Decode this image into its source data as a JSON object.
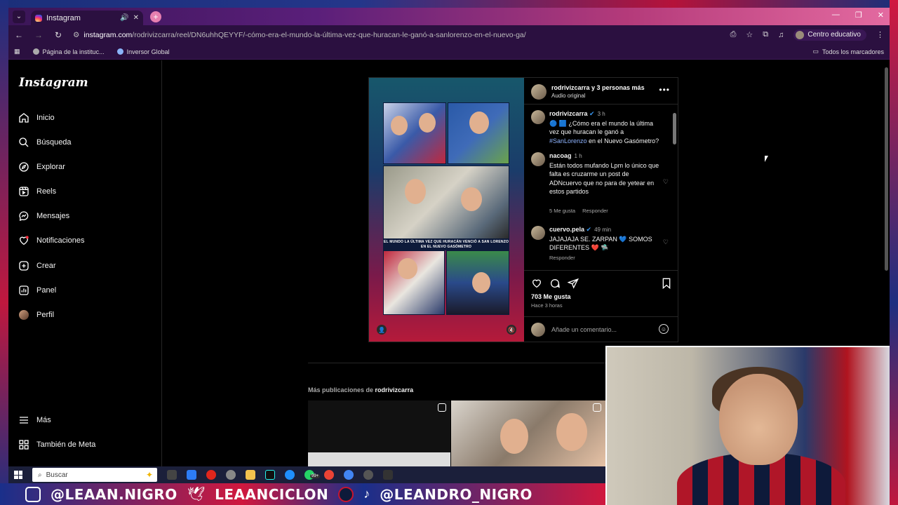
{
  "browser": {
    "tab_title": "Instagram",
    "url_host": "instagram.com",
    "url_path": "/rodrivizcarra/reel/DN6uhhQEYYF/-cómo-era-el-mundo-la-última-vez-que-huracan-le-ganó-a-sanlorenzo-en-el-nuevo-ga/",
    "profile_label": "Centro educativo",
    "bookmarks": [
      "Página de la instituc...",
      "Inversor Global"
    ],
    "bookmarks_right": "Todos los marcadores"
  },
  "instagram": {
    "logo": "Instagram",
    "nav": [
      {
        "label": "Inicio",
        "icon": "home-icon"
      },
      {
        "label": "Búsqueda",
        "icon": "search-icon"
      },
      {
        "label": "Explorar",
        "icon": "compass-icon"
      },
      {
        "label": "Reels",
        "icon": "reels-icon"
      },
      {
        "label": "Mensajes",
        "icon": "messenger-icon"
      },
      {
        "label": "Notificaciones",
        "icon": "heart-icon"
      },
      {
        "label": "Crear",
        "icon": "plus-square-icon"
      },
      {
        "label": "Panel",
        "icon": "dashboard-icon"
      },
      {
        "label": "Perfil",
        "icon": "avatar"
      }
    ],
    "nav_bottom": [
      {
        "label": "Más",
        "icon": "menu-icon"
      },
      {
        "label": "También de Meta",
        "icon": "meta-grid-icon"
      }
    ],
    "post": {
      "header_user": "rodrivizcarra y 3 personas más",
      "header_sub": "Audio original",
      "image_caption": "EL MUNDO LA ÚLTIMA VEZ QUE HURACÁN VENCIÓ A SAN LORENZO EN EL NUEVO GASÓMETRO",
      "comments": [
        {
          "user": "rodrivizcarra",
          "time": "3 h",
          "text_pre": "🔵 🟦 ¿Cómo era el mundo la última vez que huracan le ganó a ",
          "hashtag": "#SanLorenzo",
          "text_post": " en el Nuevo Gasómetro?"
        },
        {
          "user": "nacoag",
          "time": "1 h",
          "text": "Están todos mufando Lpm lo único que falta es cruzarme un post de ADNcuervo que no para de yetear en estos partidos",
          "likes": "5 Me gusta",
          "reply": "Responder"
        },
        {
          "user": "cuervo.pela",
          "time": "49 min",
          "text": "JAJAJAJA SE. ZARPAN 💙 SOMOS DIFERENTES ❤️ 🛸",
          "reply": "Responder"
        }
      ],
      "likes": "703 Me gusta",
      "posted_ago": "Hace 3 horas",
      "comment_placeholder": "Añade un comentario..."
    },
    "more_posts_prefix": "Más publicaciones de",
    "more_posts_user": "rodrivizcarra"
  },
  "taskbar": {
    "search_placeholder": "Buscar",
    "badge": "99+"
  },
  "banner": {
    "handles": [
      "@LEAAN.NIGRO",
      "LEAANCICLON",
      "@LEANDRO_NIGRO"
    ]
  },
  "colors": {
    "accent_blue": "#8fb4ff",
    "ig_bg": "#000000",
    "stream_red": "#d0183e",
    "stream_blue": "#1a2f8a"
  }
}
